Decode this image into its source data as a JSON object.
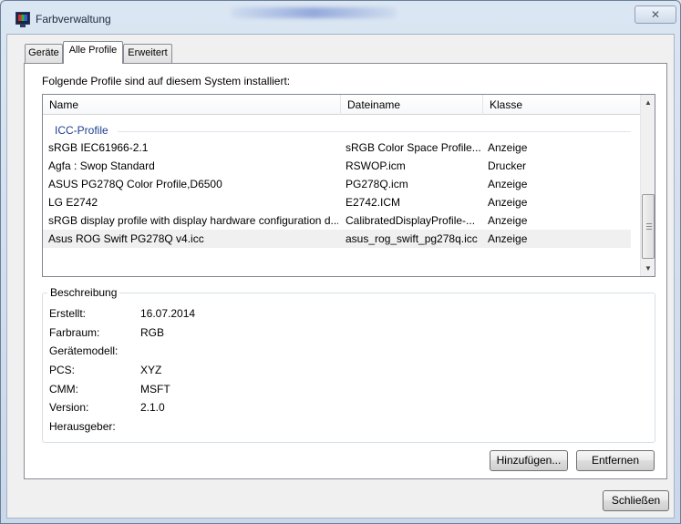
{
  "window": {
    "title": "Farbverwaltung",
    "close_glyph": "✕"
  },
  "tabs": [
    {
      "label": "Geräte"
    },
    {
      "label": "Alle Profile"
    },
    {
      "label": "Erweitert"
    }
  ],
  "panel": {
    "intro": "Folgende Profile sind auf diesem System installiert:"
  },
  "list": {
    "columns": [
      "Name",
      "Dateiname",
      "Klasse"
    ],
    "group_label": "ICC-Profile",
    "rows": [
      {
        "name": "sRGB IEC61966-2.1",
        "file": "sRGB Color Space Profile....",
        "class": "Anzeige"
      },
      {
        "name": "Agfa : Swop Standard",
        "file": "RSWOP.icm",
        "class": "Drucker"
      },
      {
        "name": "ASUS PG278Q Color Profile,D6500",
        "file": "PG278Q.icm",
        "class": "Anzeige"
      },
      {
        "name": "LG E2742",
        "file": "E2742.ICM",
        "class": "Anzeige"
      },
      {
        "name": "sRGB display profile with display hardware configuration d...",
        "file": "CalibratedDisplayProfile-...",
        "class": "Anzeige"
      },
      {
        "name": "Asus ROG Swift PG278Q v4.icc",
        "file": "asus_rog_swift_pg278q.icc",
        "class": "Anzeige"
      }
    ],
    "selected_row": 5
  },
  "description": {
    "title": "Beschreibung",
    "fields": [
      {
        "label": "Erstellt:",
        "value": "16.07.2014"
      },
      {
        "label": "Farbraum:",
        "value": "RGB"
      },
      {
        "label": "Gerätemodell:",
        "value": ""
      },
      {
        "label": "PCS:",
        "value": "XYZ"
      },
      {
        "label": "CMM:",
        "value": "MSFT"
      },
      {
        "label": "Version:",
        "value": "2.1.0"
      },
      {
        "label": "Herausgeber:",
        "value": ""
      }
    ]
  },
  "buttons": {
    "add": "Hinzufügen...",
    "remove": "Entfernen",
    "close": "Schließen"
  },
  "icons": {
    "scroll_up": "▲",
    "scroll_down": "▼"
  }
}
